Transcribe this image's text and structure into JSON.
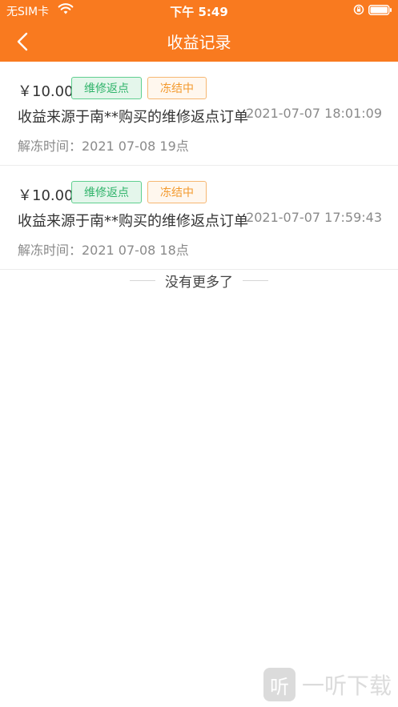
{
  "status_bar": {
    "carrier": "无SIM卡",
    "time": "下午 5:49",
    "icons": [
      "wifi-icon",
      "orientation-lock-icon",
      "battery-icon"
    ]
  },
  "nav": {
    "title": "收益记录",
    "back_icon": "chevron-left-icon"
  },
  "colors": {
    "header_bg": "#f97a1f",
    "tag_green": "#2fb36a",
    "tag_orange": "#f39a2e"
  },
  "records": [
    {
      "amount": "￥10.00",
      "type_tag": "维修返点",
      "status_tag": "冻结中",
      "description": "收益来源于南**购买的维修返点订单",
      "time": "2021-07-07 18:01:09",
      "unfreeze": "解冻时间：2021 07-08 19点"
    },
    {
      "amount": "￥10.00",
      "type_tag": "维修返点",
      "status_tag": "冻结中",
      "description": "收益来源于南**购买的维修返点订单",
      "time": "2021-07-07 17:59:43",
      "unfreeze": "解冻时间：2021 07-08 18点"
    }
  ],
  "footer": {
    "no_more": "没有更多了"
  },
  "watermark": {
    "text": "一听下载",
    "logo_char": "听"
  }
}
